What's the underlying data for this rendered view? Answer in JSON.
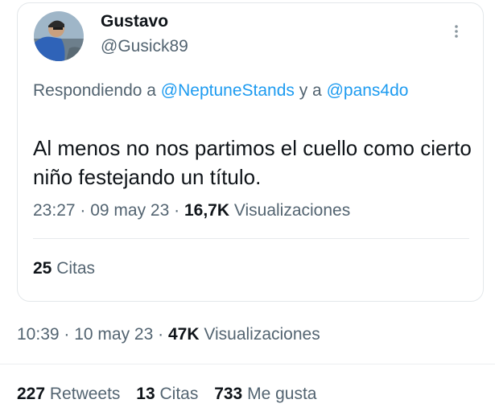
{
  "quoted_tweet": {
    "author": {
      "display_name": "Gustavo",
      "handle": "@Gusick89",
      "avatar_icon": "user-avatar"
    },
    "more_icon": "more-vertical-icon",
    "replying": {
      "prefix": "Respondiendo a ",
      "mention1": "@NeptuneStands",
      "joiner": " y a ",
      "mention2": "@pans4do"
    },
    "text": "Al menos no nos partimos el cuello como cierto niño festejando un título.",
    "time": "23:27",
    "date": "09 may 23",
    "views_count": "16,7K",
    "views_label": "Visualizaciones",
    "quotes_count": "25",
    "quotes_label": "Citas"
  },
  "post_meta": {
    "time": "10:39",
    "date": "10 may 23",
    "views_count": "47K",
    "views_label": "Visualizaciones"
  },
  "stats": {
    "retweets_count": "227",
    "retweets_label": "Retweets",
    "quotes_count": "13",
    "quotes_label": "Citas",
    "likes_count": "733",
    "likes_label": "Me gusta"
  },
  "colors": {
    "link": "#1d9bf0",
    "secondary_text": "#536471",
    "primary_text": "#0f1419"
  }
}
